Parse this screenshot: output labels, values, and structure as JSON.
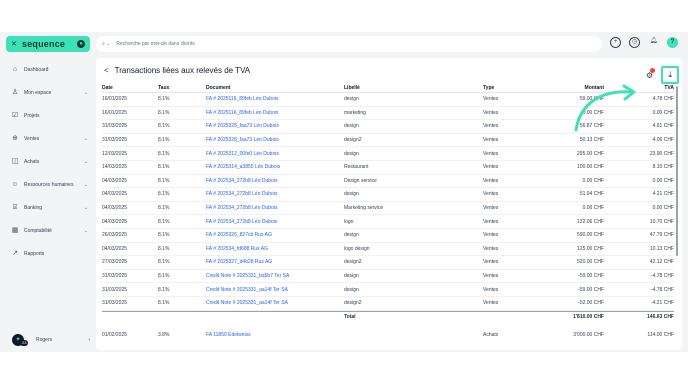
{
  "brand": {
    "name": "sequence"
  },
  "sidebar": {
    "items": [
      {
        "label": "Dashboard",
        "icon": "home-icon",
        "chev": ""
      },
      {
        "label": "Mon espace",
        "icon": "user-icon",
        "chev": "⌄"
      },
      {
        "label": "Projets",
        "icon": "check-square-icon",
        "chev": ""
      },
      {
        "label": "Ventes",
        "icon": "sales-icon",
        "chev": "⌄"
      },
      {
        "label": "Achats",
        "icon": "bag-icon",
        "chev": "⌄"
      },
      {
        "label": "Ressources humaines",
        "icon": "people-icon",
        "chev": "⌄"
      },
      {
        "label": "Banking",
        "icon": "bank-icon",
        "chev": "⌄"
      },
      {
        "label": "Comptabilité",
        "icon": "calculator-icon",
        "chev": "⌄"
      },
      {
        "label": "Rapports",
        "icon": "chart-icon",
        "chev": ""
      }
    ],
    "bottom": {
      "label": "Rogers",
      "badge": "23"
    }
  },
  "search": {
    "placeholder": "Recherche par mot-clé dans clients"
  },
  "panel": {
    "back": "<",
    "title": "Transactions liées aux relevés de TVA"
  },
  "table": {
    "headers": {
      "date": "Date",
      "taux": "Taux",
      "doc": "Document",
      "lib": "Libellé",
      "type": "Type",
      "mont": "Montant",
      "tva": "TVA"
    },
    "rows": [
      {
        "date": "16/01/2025",
        "taux": "8.1%",
        "doc": "FA # 2025116_89feb Léo Dubois",
        "lib": "design",
        "type": "Ventes",
        "mont": "59.00 CHF",
        "tva": "4.78 CHF"
      },
      {
        "date": "16/01/2025",
        "taux": "8.1%",
        "doc": "FA # 2025116_89feb Léo Dubois",
        "lib": "marketing",
        "type": "Ventes",
        "mont": "0.00 CHF",
        "tva": "0.00 CHF"
      },
      {
        "date": "31/03/2025",
        "taux": "8.1%",
        "doc": "FA # 2025328_faa73 Léo Dubois",
        "lib": "design",
        "type": "Ventes",
        "mont": "56.87 CHF",
        "tva": "4.61 CHF"
      },
      {
        "date": "31/03/2025",
        "taux": "8.1%",
        "doc": "FA # 2025328_faa73 Léo Dubois",
        "lib": "design2",
        "type": "Ventes",
        "mont": "50.13 CHF",
        "tva": "4.06 CHF"
      },
      {
        "date": "12/03/2025",
        "taux": "8.1%",
        "doc": "FA # 2025312_00fe0 Léo Dubois",
        "lib": "design",
        "type": "Ventes",
        "mont": "295.00 CHF",
        "tva": "23.90 CHF"
      },
      {
        "date": "14/03/2025",
        "taux": "8.1%",
        "doc": "FA # 2025314_a3855 Léo Dubois",
        "lib": "Restaurant",
        "type": "Ventes",
        "mont": "100.00 CHF",
        "tva": "8.10 CHF"
      },
      {
        "date": "04/03/2025",
        "taux": "8.1%",
        "doc": "FA # 202534_272b8 Léo Dubois",
        "lib": "Design service",
        "type": "Ventes",
        "mont": "0.00 CHF",
        "tva": "0.00 CHF"
      },
      {
        "date": "04/03/2025",
        "taux": "8.1%",
        "doc": "FA # 202534_272b8 Léo Dubois",
        "lib": "design",
        "type": "Ventes",
        "mont": "51.94 CHF",
        "tva": "4.21 CHF"
      },
      {
        "date": "04/03/2025",
        "taux": "8.1%",
        "doc": "FA # 202534_272b8 Léo Dubois",
        "lib": "Marketing service",
        "type": "Ventes",
        "mont": "0.00 CHF",
        "tva": "0.00 CHF"
      },
      {
        "date": "04/03/2025",
        "taux": "8.1%",
        "doc": "FA # 202534_272b8 Léo Dubois",
        "lib": "logo",
        "type": "Ventes",
        "mont": "132.06 CHF",
        "tva": "10.70 CHF"
      },
      {
        "date": "26/03/2025",
        "taux": "8.1%",
        "doc": "FA # 2025326_827cb Rus AG",
        "lib": "design",
        "type": "Ventes",
        "mont": "590.00 CHF",
        "tva": "47.79 CHF"
      },
      {
        "date": "04/03/2025",
        "taux": "8.1%",
        "doc": "FA # 202534_fd688 Rus AG",
        "lib": "logo design",
        "type": "Ventes",
        "mont": "125.00 CHF",
        "tva": "10.13 CHF"
      },
      {
        "date": "27/03/2025",
        "taux": "8.1%",
        "doc": "FA # 2025327_d4b28 Rus AG",
        "lib": "design2",
        "type": "Ventes",
        "mont": "520.00 CHF",
        "tva": "42.12 CHF"
      },
      {
        "date": "31/03/2025",
        "taux": "8.1%",
        "doc": "Credit Note # 2025331_ba5b7 Ter SA",
        "lib": "design",
        "type": "Ventes",
        "mont": "-59.00 CHF",
        "tva": "-4.78 CHF"
      },
      {
        "date": "31/03/2025",
        "taux": "8.1%",
        "doc": "Credit Note # 2025331_aa14f Ter SA",
        "lib": "design",
        "type": "Ventes",
        "mont": "-59.00 CHF",
        "tva": "-4.78 CHF"
      },
      {
        "date": "31/03/2025",
        "taux": "8.1%",
        "doc": "Credit Note # 2025331_aa14f Ter SA",
        "lib": "design2",
        "type": "Ventes",
        "mont": "-52.00 CHF",
        "tva": "-4.21 CHF"
      }
    ],
    "total": {
      "label": "Total",
      "mont": "1'810.00 CHF",
      "tva": "146.63 CHF"
    },
    "extra": {
      "date": "01/02/2025",
      "taux": "3.8%",
      "doc": "FA 11850 Edelweiss",
      "type": "Achats",
      "mont": "3'000.00 CHF",
      "tva": "114.00 CHF"
    }
  },
  "colors": {
    "accent": "#3ee0b5",
    "link": "#2563eb"
  }
}
